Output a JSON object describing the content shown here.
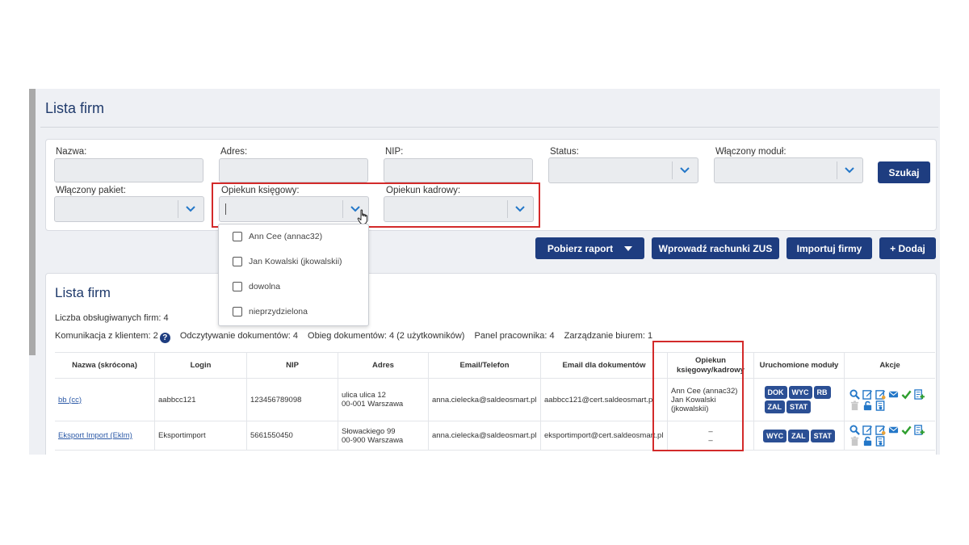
{
  "page_title": "Lista firm",
  "filters": {
    "nazwa_label": "Nazwa:",
    "adres_label": "Adres:",
    "nip_label": "NIP:",
    "status_label": "Status:",
    "modul_label": "Włączony moduł:",
    "pakiet_label": "Włączony pakiet:",
    "ksiegowy_label": "Opiekun księgowy:",
    "kadrowy_label": "Opiekun kadrowy:",
    "search_button": "Szukaj"
  },
  "dropdown": {
    "options": [
      {
        "label": "Ann Cee (annac32)",
        "checked": false
      },
      {
        "label": "Jan Kowalski (jkowalskii)",
        "checked": false
      },
      {
        "label": "dowolna",
        "checked": false
      },
      {
        "label": "nieprzydzielona",
        "checked": false
      }
    ]
  },
  "toolbar": {
    "report_button": "Pobierz raport",
    "zus_button": "Wprowadź rachunki ZUS",
    "import_button": "Importuj firmy",
    "add_button": "+ Dodaj"
  },
  "list": {
    "title": "Lista firm",
    "count_text": "Liczba obsługiwanych firm: 4",
    "communication_text": "Komunikacja z klientem: 2",
    "reading_text": "Odczytywanie dokumentów: 4",
    "flow_text": "Obieg dokumentów: 4 (2 użytkowników)",
    "panel_text": "Panel pracownika: 4",
    "office_text": "Zarządzanie biurem: 1"
  },
  "table": {
    "headers": [
      "Nazwa (skrócona)",
      "Login",
      "NIP",
      "Adres",
      "Email/Telefon",
      "Email dla dokumentów",
      "Opiekun księgowy/kadrowy",
      "Uruchomione moduły",
      "Akcje"
    ],
    "rows": [
      {
        "name": "bb (cc)",
        "login": "aabbcc121",
        "nip": "123456789098",
        "address_line1": "ulica ulica 12",
        "address_line2": "00-001 Warszawa",
        "email": "anna.cielecka@saldeosmart.pl",
        "doc_email": "aabbcc121@cert.saldeosmart.pl",
        "guardian_line1": "Ann Cee (annac32)",
        "guardian_line2": "Jan Kowalski",
        "guardian_line3": "(jkowalskii)",
        "modules": [
          "DOK",
          "WYC",
          "RB",
          "ZAL",
          "STAT"
        ]
      },
      {
        "name": "Eksport Import (Eklm)",
        "login": "Eksportimport",
        "nip": "5661550450",
        "address_line1": "Słowackiego 99",
        "address_line2": "00-900 Warszawa",
        "email": "anna.cielecka@saldeosmart.pl",
        "doc_email": "eksportimport@cert.saldeosmart.pl",
        "guardian_line1": "–",
        "guardian_line2": "–",
        "modules": [
          "WYC",
          "ZAL",
          "STAT"
        ]
      }
    ]
  },
  "colors": {
    "primary": "#1e3d80",
    "badge": "#2b4f94",
    "highlight": "#d32a2a",
    "check": "#2e9e2e",
    "tool_blue": "#2377c8"
  }
}
